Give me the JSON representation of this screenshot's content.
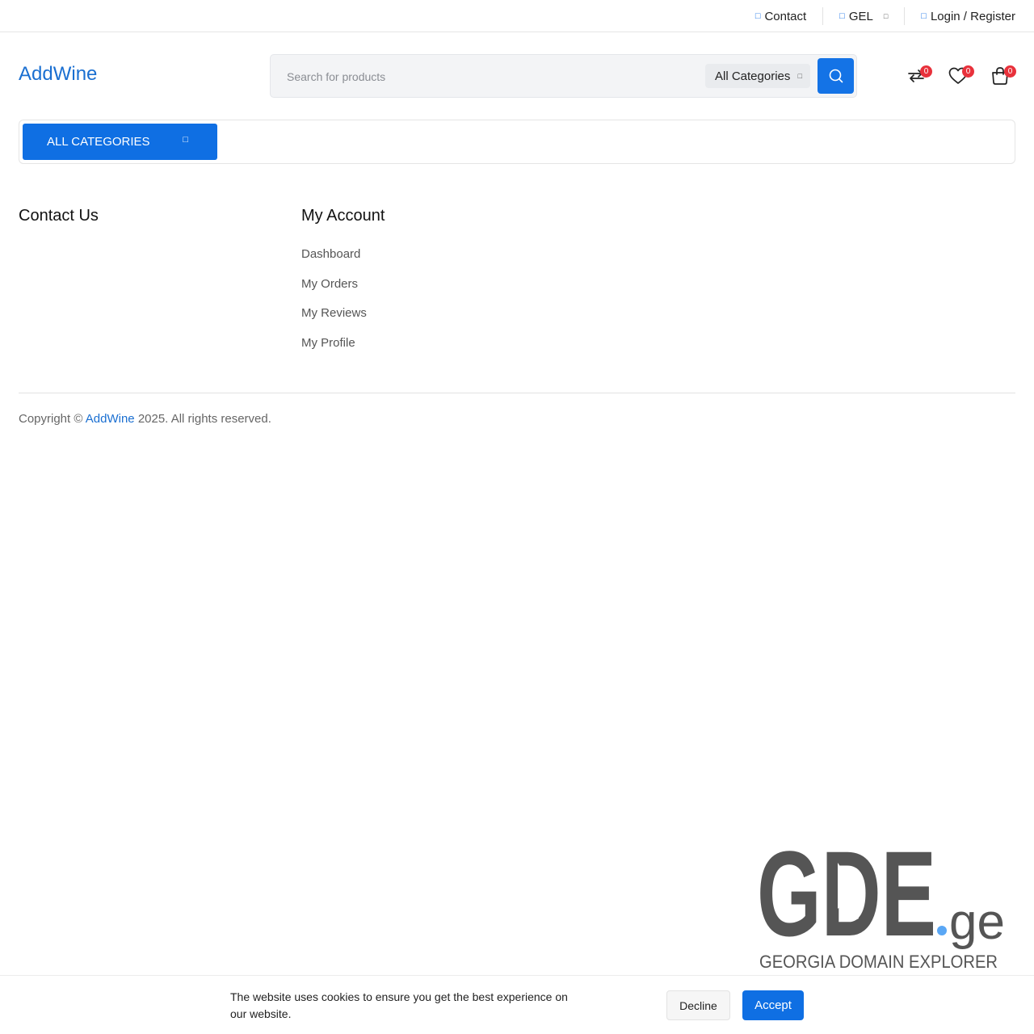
{
  "topbar": {
    "contact_label": "Contact",
    "currency_label": "GEL",
    "login_label": "Login / Register"
  },
  "header": {
    "logo_text": "AddWine",
    "search_placeholder": "Search for products",
    "category_select_value": "All Categories",
    "compare_count": "0",
    "wishlist_count": "0",
    "cart_count": "0"
  },
  "category_bar": {
    "all_categories_label": "ALL CATEGORIES"
  },
  "footer": {
    "contact_title": "Contact Us",
    "account_title": "My Account",
    "account_links": [
      "Dashboard",
      "My Orders",
      "My Reviews",
      "My Profile"
    ],
    "copyright_prefix": "Copyright ©",
    "copyright_brand": "AddWine",
    "copyright_suffix": "2025. All rights reserved."
  },
  "watermark": {
    "logo_main": "GDE",
    "logo_tld": ".ge",
    "tagline": "GEORGIA DOMAIN EXPLORER"
  },
  "cookie_bar": {
    "message": "The website uses cookies to ensure you get the best experience on our website.",
    "decline_label": "Decline",
    "accept_label": "Accept"
  },
  "colors": {
    "brand_blue": "#0f6fe3",
    "link_blue": "#1a6fd1",
    "badge_red": "#e8313b",
    "watermark_gray": "#555555",
    "watermark_dot": "#5aa7f5"
  }
}
